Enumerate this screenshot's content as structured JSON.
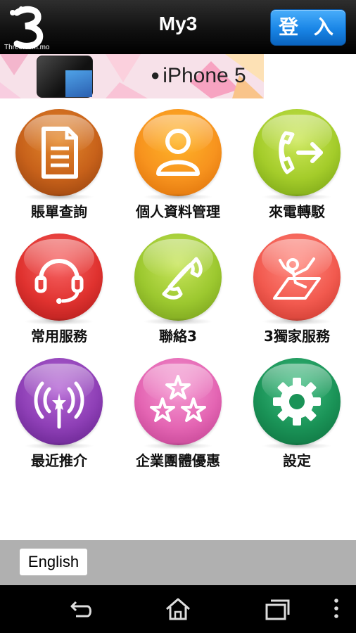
{
  "header": {
    "logo_text": "Three.com.mo",
    "title": "My3",
    "login_label": "登 入"
  },
  "banner": {
    "text": "iPhone 5"
  },
  "menu": [
    {
      "label": "賬單查詢",
      "icon": "bill-icon",
      "color": "#c7611a"
    },
    {
      "label": "個人資料管理",
      "icon": "person-icon",
      "color": "#f7931e"
    },
    {
      "label": "來電轉駁",
      "icon": "call-forward-icon",
      "color": "#a4cc2a"
    },
    {
      "label": "常用服務",
      "icon": "headset-icon",
      "color": "#e0322f"
    },
    {
      "label": "聯絡3",
      "icon": "phone-icon",
      "color": "#9cc82f"
    },
    {
      "label": "3獨家服務",
      "icon": "relax-icon",
      "color": "#f25a4f"
    },
    {
      "label": "最近推介",
      "icon": "broadcast-icon",
      "color": "#8e3fb6"
    },
    {
      "label": "企業團體優惠",
      "icon": "stars-icon",
      "color": "#e465b3"
    },
    {
      "label": "設定",
      "icon": "gear-icon",
      "color": "#1a9357"
    }
  ],
  "footer": {
    "language_button": "English"
  }
}
